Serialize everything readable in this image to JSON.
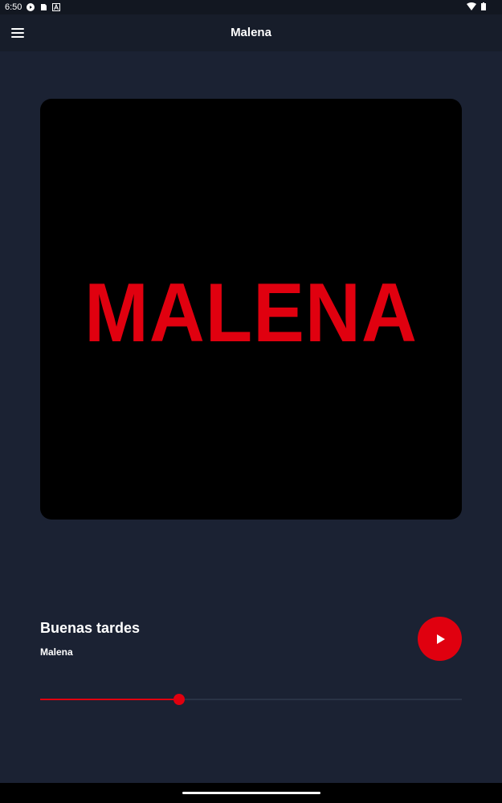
{
  "status_bar": {
    "time": "6:50",
    "left_icons": [
      "shield-icon",
      "sim-card-icon",
      "font-a-icon"
    ],
    "right_icons": [
      "wifi-icon",
      "battery-icon"
    ]
  },
  "app_bar": {
    "title": "Malena",
    "menu_icon": "hamburger-menu-icon"
  },
  "cover": {
    "logo_text": "MALENA",
    "logo_color": "#e0000f",
    "background_color": "#000000"
  },
  "now_playing": {
    "title": "Buenas tardes",
    "artist": "Malena",
    "play_icon": "play-icon"
  },
  "progress": {
    "fraction": 0.33
  },
  "colors": {
    "accent": "#e0000f",
    "background": "#1b2233",
    "app_bar": "#171d2a"
  }
}
